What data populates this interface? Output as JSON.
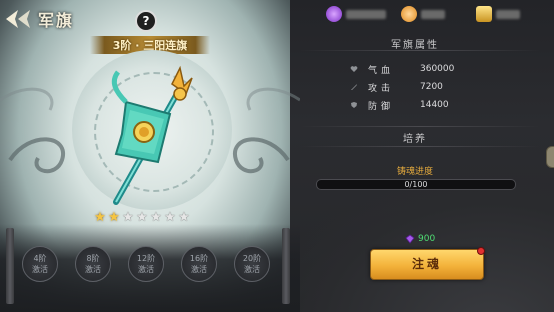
{
  "header": {
    "title": "军旗",
    "help_label": "?"
  },
  "currencies": [
    {
      "icon": "purple-gem-icon",
      "color": "#9b4fe0"
    },
    {
      "icon": "gold-coin-icon",
      "color": "#f2a93b"
    },
    {
      "icon": "ingot-icon",
      "color": "#f0c94a"
    }
  ],
  "banner": {
    "name": "3阶 · 三阳连旗"
  },
  "stars": {
    "filled": 2,
    "total": 7
  },
  "badges": [
    {
      "line1": "4阶",
      "line2": "激活"
    },
    {
      "line1": "8阶",
      "line2": "激活"
    },
    {
      "line1": "12阶",
      "line2": "激活"
    },
    {
      "line1": "16阶",
      "line2": "激活"
    },
    {
      "line1": "20阶",
      "line2": "激活"
    }
  ],
  "attributes": {
    "title": "军旗属性",
    "rows": [
      {
        "label": "气血",
        "value": "360000"
      },
      {
        "label": "攻击",
        "value": "7200"
      },
      {
        "label": "防御",
        "value": "14400"
      }
    ]
  },
  "cultivate": {
    "title": "培养",
    "progress_label": "铸魂进度",
    "progress_text": "0/100",
    "progress_value": 0,
    "cost": "900",
    "button_label": "注魂"
  },
  "colors": {
    "accent_gold": "#f3b23a",
    "cost_green": "#4fdc73",
    "progress_orange": "#e3a93d"
  }
}
